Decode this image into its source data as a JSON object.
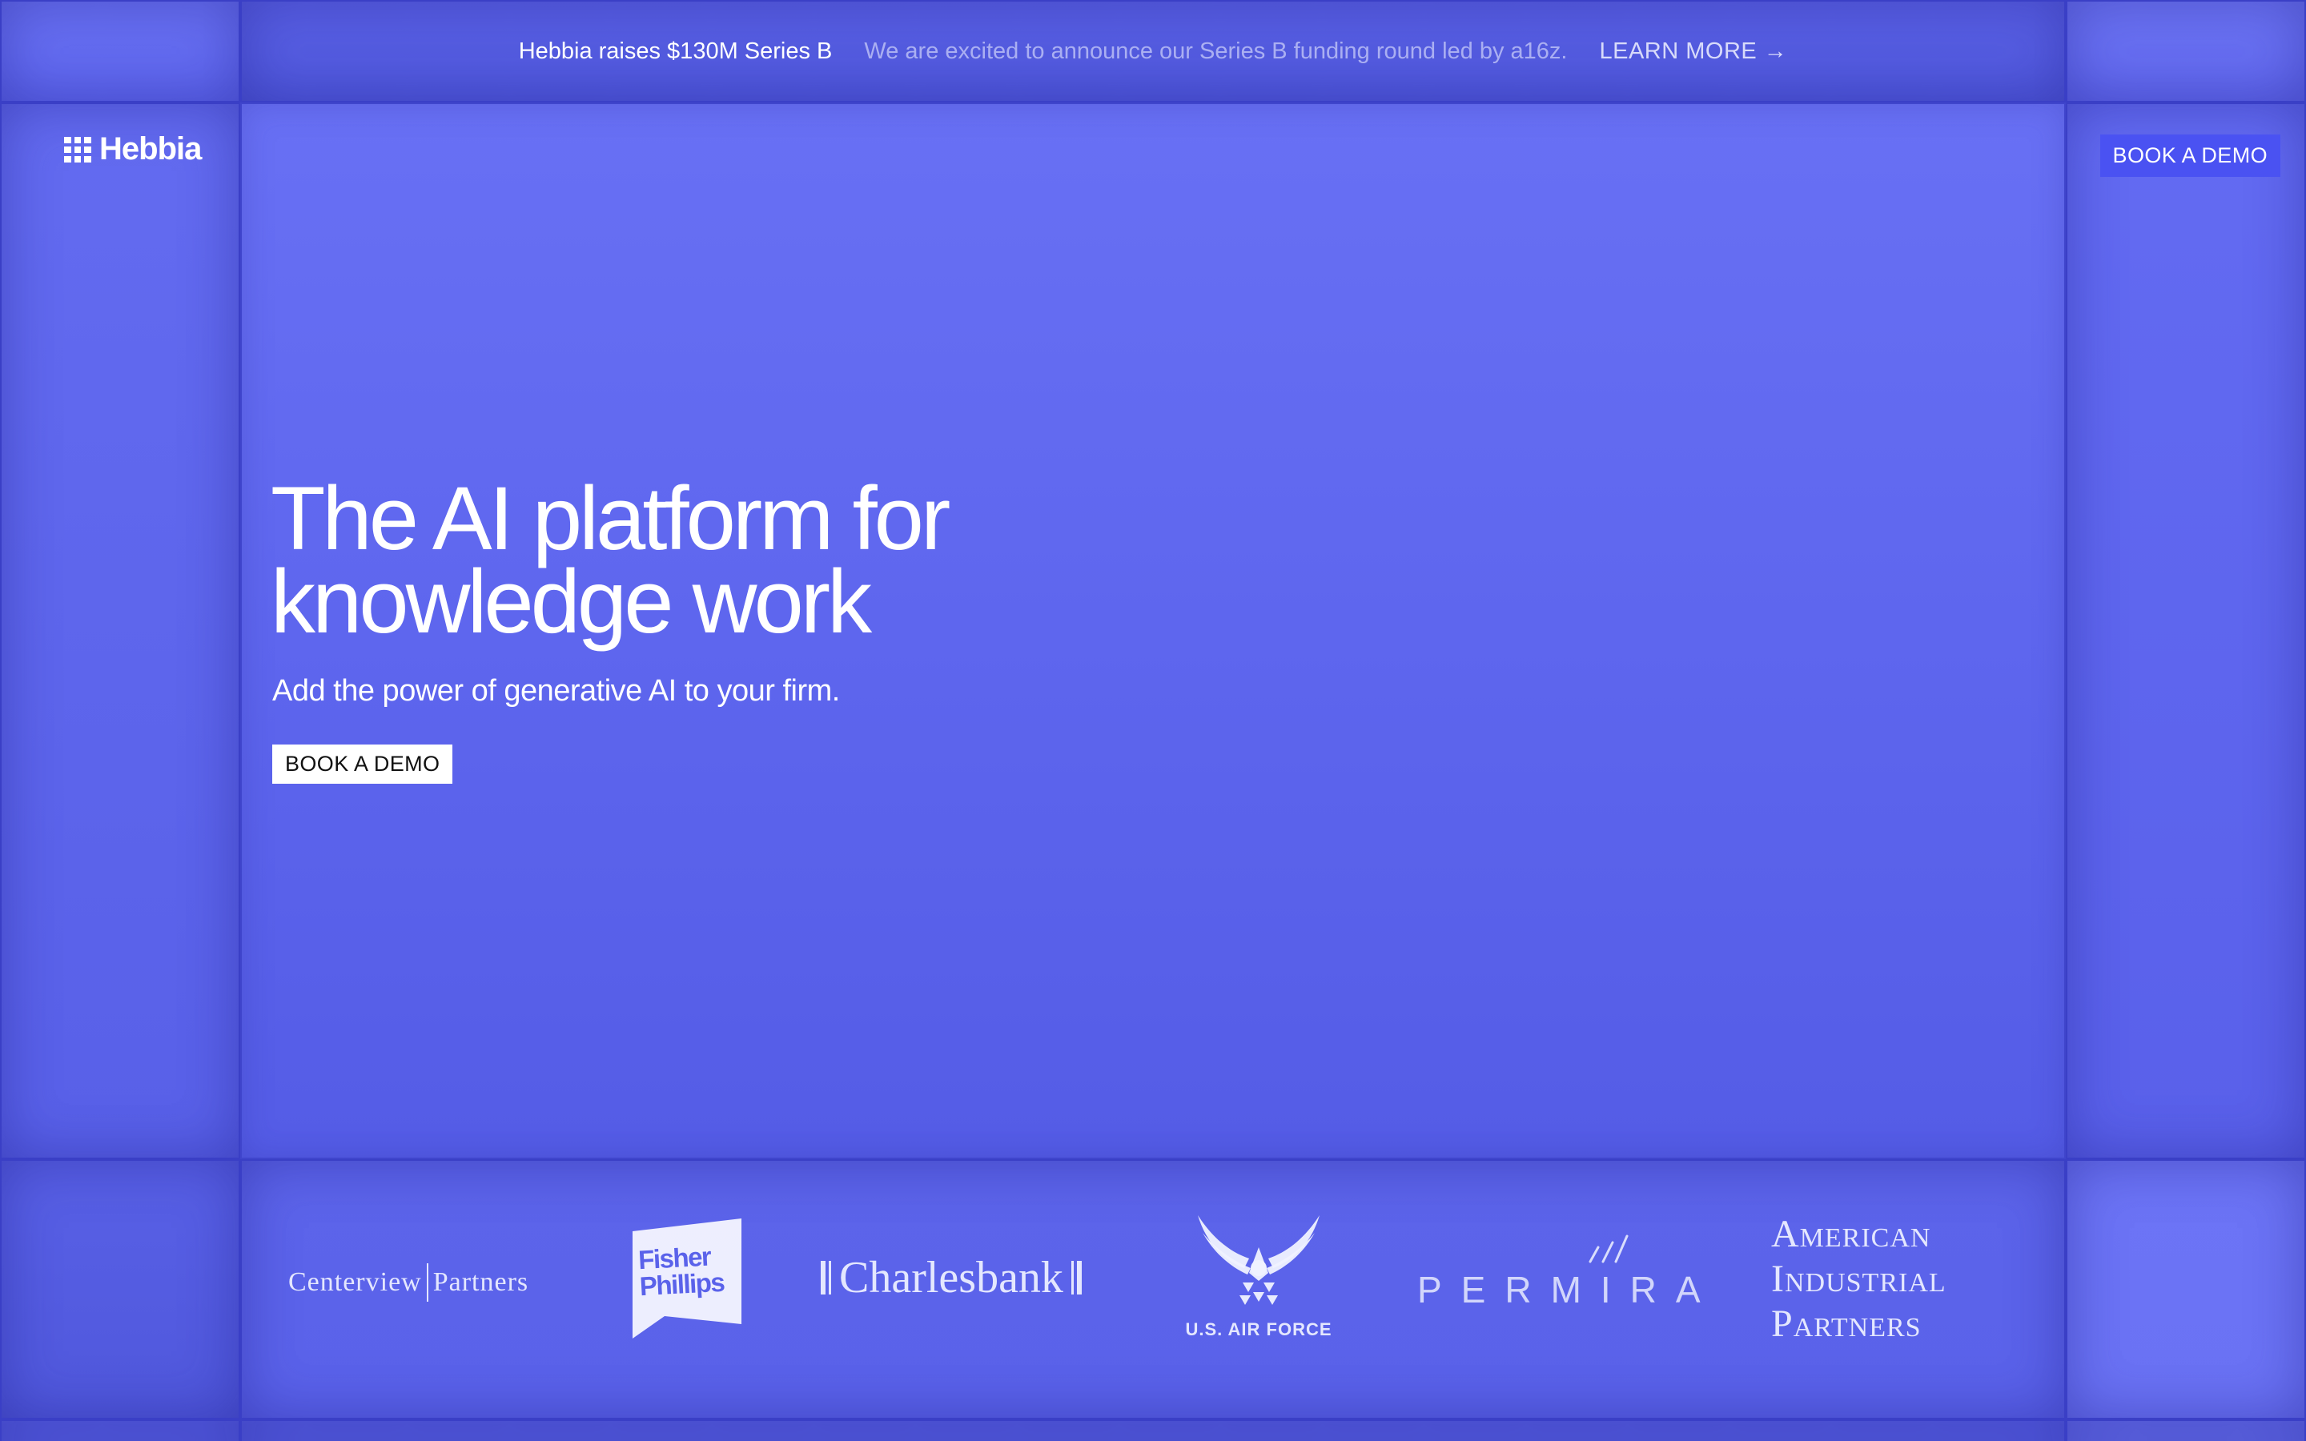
{
  "announcement": {
    "headline": "Hebbia raises $130M Series B",
    "description": "We are excited to announce our Series B funding round led by a16z.",
    "link_label": "LEARN MORE →"
  },
  "nav": {
    "logo_text": "Hebbia",
    "logo_icon": "grid-icon",
    "demo_label": "BOOK A DEMO"
  },
  "hero": {
    "title_line1": "The AI platform for",
    "title_line2": "knowledge work",
    "subtitle": "Add the power of generative AI to your firm.",
    "cta_label": "BOOK A DEMO"
  },
  "customers": {
    "centerview": {
      "part1": "Centerview",
      "part2": "Partners"
    },
    "fisher_phillips": {
      "line1": "Fisher",
      "line2": "Phillips"
    },
    "charlesbank": {
      "name": "Charlesbank"
    },
    "air_force": {
      "name": "U.S. AIR FORCE",
      "icon": "air-force-wings-icon"
    },
    "permira": {
      "name": "PERMIRA"
    },
    "american_industrial": {
      "line1": "American",
      "line2": "Industrial",
      "line3": "Partners"
    }
  },
  "colors": {
    "background": "#5c65ec",
    "nav_button": "#4a52f2",
    "text": "#ffffff"
  }
}
